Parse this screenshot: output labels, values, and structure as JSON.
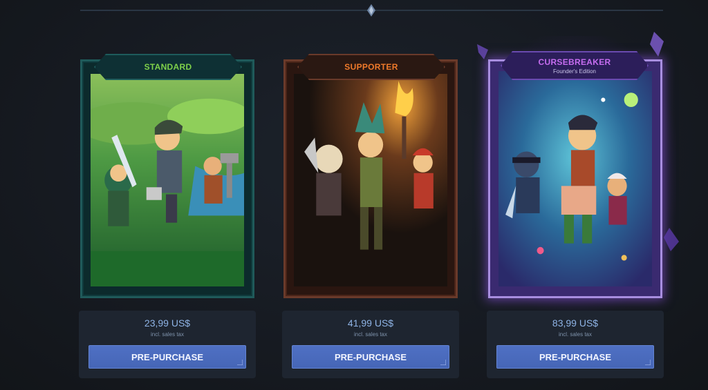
{
  "editions": [
    {
      "tier": "STANDARD",
      "subtitle": "",
      "price": "23,99 US$",
      "tax_note": "incl. sales tax",
      "button": "PRE-PURCHASE",
      "accent": "#7fd14a"
    },
    {
      "tier": "SUPPORTER",
      "subtitle": "",
      "price": "41,99 US$",
      "tax_note": "incl. sales tax",
      "button": "PRE-PURCHASE",
      "accent": "#f07a2a"
    },
    {
      "tier": "CURSEBREAKER",
      "subtitle": "Founder's Edition",
      "price": "83,99 US$",
      "tax_note": "incl. sales tax",
      "button": "PRE-PURCHASE",
      "accent": "#c66df0"
    }
  ],
  "icons": {
    "divider": "diamond-gem-icon",
    "button_corner": "corner-accent-icon"
  }
}
